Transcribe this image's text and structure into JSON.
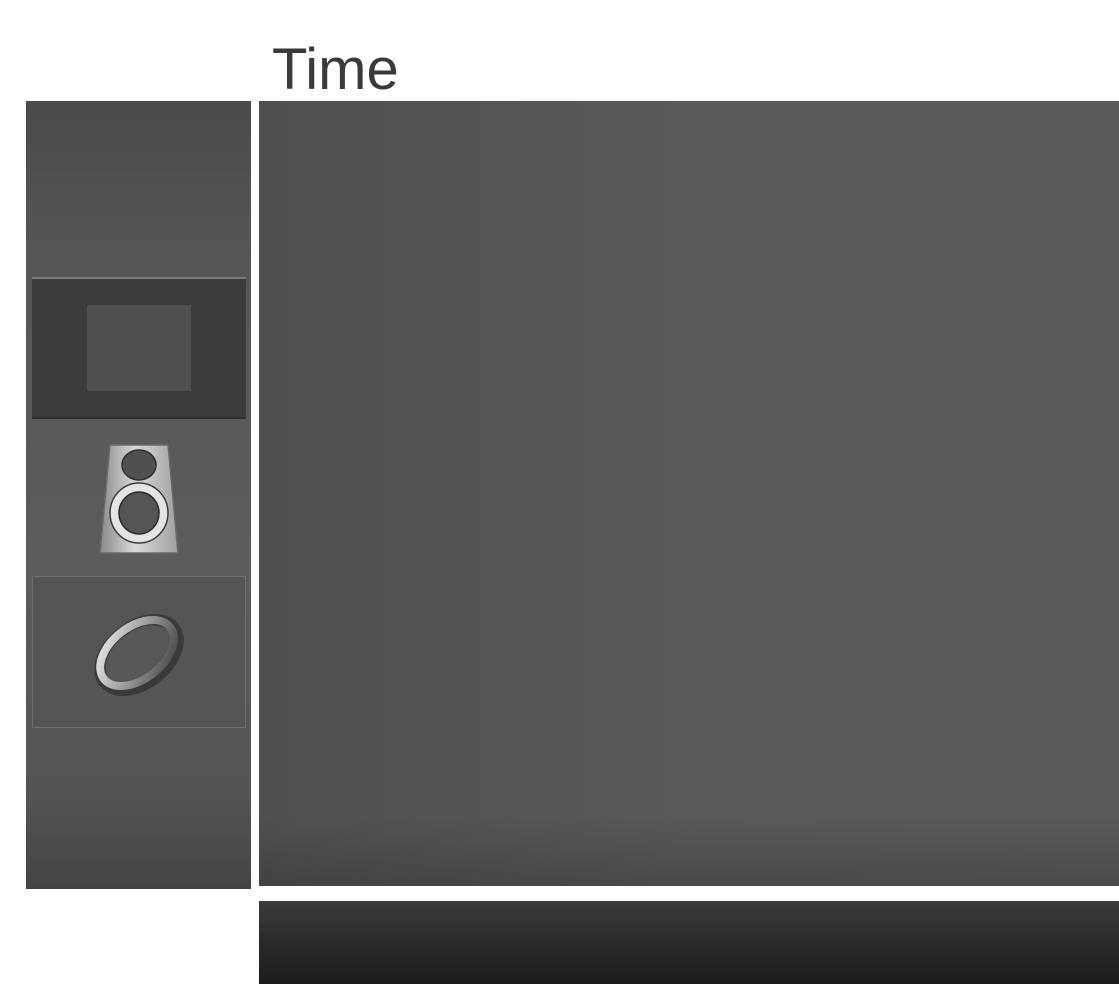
{
  "menu": {
    "title": "Time"
  },
  "sidebar": {
    "items": [
      {
        "icon": "picture-icon",
        "selected": false
      },
      {
        "icon": "speaker-icon",
        "selected": false
      },
      {
        "icon": "clock-icon",
        "selected": true
      }
    ]
  },
  "colors": {
    "panel": "#595959",
    "sidebar": "#565656",
    "bottom_bar": "#2a2a2a",
    "title_text": "#3a3a3a"
  }
}
